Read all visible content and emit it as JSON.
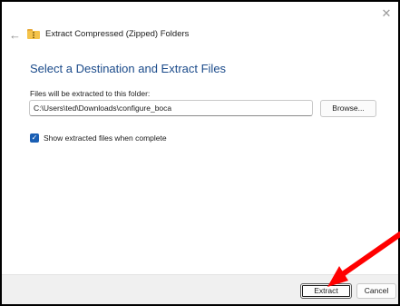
{
  "window": {
    "close_glyph": "✕",
    "back_glyph": "←",
    "title": "Extract Compressed (Zipped) Folders",
    "title_icon": "zipped-folder-icon"
  },
  "main": {
    "heading": "Select a Destination and Extract Files",
    "path_label": "Files will be extracted to this folder:",
    "path_value": "C:\\Users\\ted\\Downloads\\configure_boca",
    "browse_label": "Browse...",
    "show_files_label": "Show extracted files when complete",
    "show_files_checked": true
  },
  "footer": {
    "extract_label": "Extract",
    "cancel_label": "Cancel"
  },
  "annotation": {
    "arrow_color": "#ff0000",
    "arrow_icon": "red-pointer-arrow"
  },
  "colors": {
    "heading": "#1a4a8a",
    "accent": "#1a5fb4"
  }
}
